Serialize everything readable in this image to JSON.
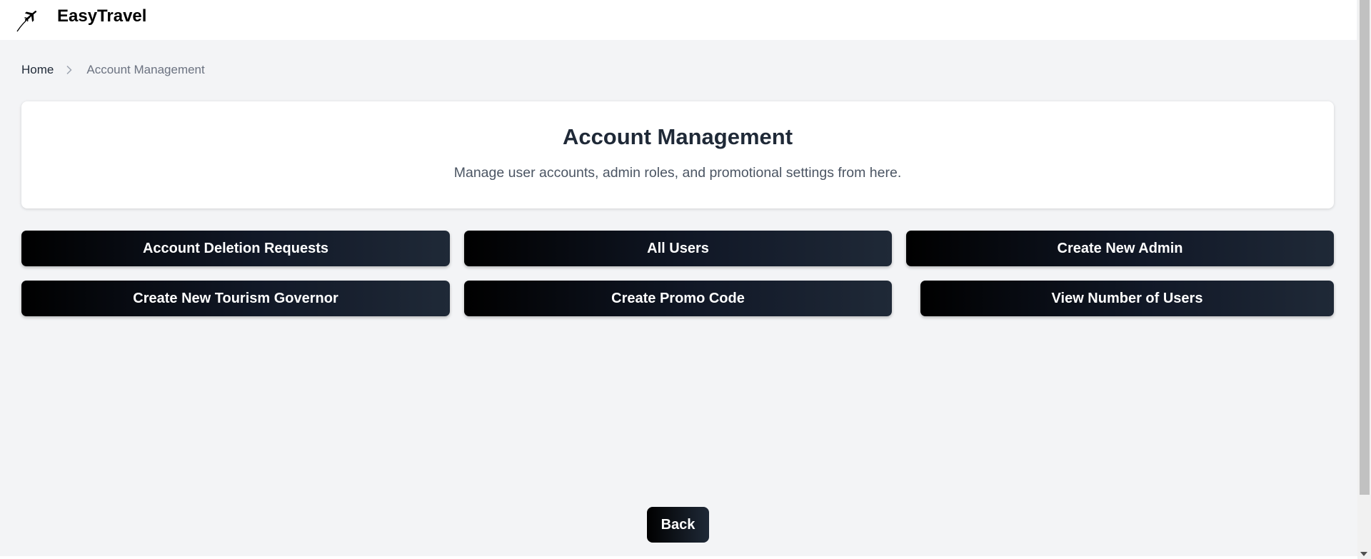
{
  "header": {
    "brand": "EasyTravel",
    "logo_icon": "airplane-icon"
  },
  "breadcrumb": {
    "home": "Home",
    "separator_icon": "chevron-right-icon",
    "current": "Account Management"
  },
  "hero": {
    "title": "Account Management",
    "subtitle": "Manage user accounts, admin roles, and promotional settings from here."
  },
  "actions": [
    {
      "label": "Account Deletion Requests"
    },
    {
      "label": "All Users"
    },
    {
      "label": "Create New Admin"
    },
    {
      "label": "Create New Tourism Governor"
    },
    {
      "label": "Create Promo Code"
    },
    {
      "label": "View Number of Users"
    }
  ],
  "back_label": "Back",
  "colors": {
    "page_bg": "#f3f4f6",
    "button_start": "#000000",
    "button_end": "#1f2937",
    "title": "#1f2937",
    "subtitle": "#4b5563"
  }
}
